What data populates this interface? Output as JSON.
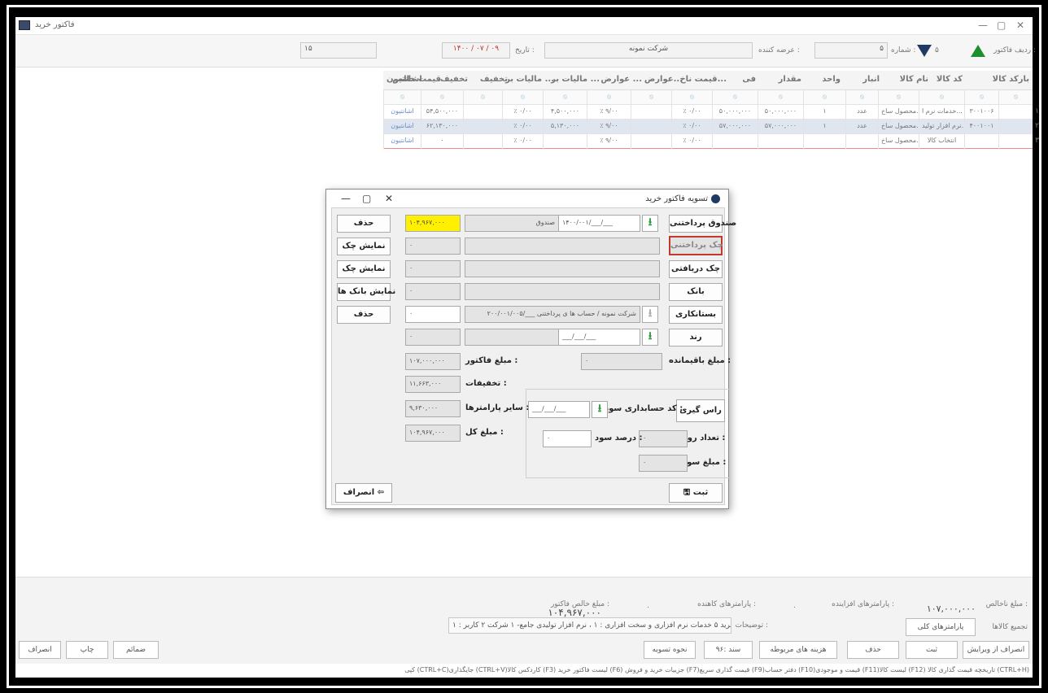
{
  "window": {
    "title": "فاکتور خرید",
    "ctl_min": "—",
    "ctl_max": "▢",
    "ctl_close": "✕"
  },
  "header": {
    "row_label": "ردیف فاکتور :",
    "row_value": "۵",
    "number_label": "شماره :",
    "number_value": "۵",
    "supplier_label": "عرضه کننده :",
    "company": "شرکت نمونه",
    "date_label": "تاریخ :",
    "date_value": "۱۴۰۰ / ۰۷ / ۰۹",
    "count": "۱۵"
  },
  "grid": {
    "headers": [
      "بارکد کالا",
      "کد کالا",
      "نام کالا",
      "انبار",
      "واحد",
      "مقدار",
      "فی",
      "قیمت ناخ...",
      "عوارض...",
      "عوارض ...",
      "مالیات بر ...",
      "مالیات بر ...",
      "تخفیف",
      "تخفیف",
      "قیمت خالص",
      "اشانتیون"
    ],
    "rows": [
      {
        "num": "۱",
        "barcode": "",
        "code": "۳۰۰۱۰۰۶",
        "name": "خدمات نرم ا...",
        "warehouse": "محصول ساخ...",
        "unit": "عدد",
        "qty": "۱",
        "price": "۵۰,۰۰۰,۰۰۰",
        "gross": "۵۰,۰۰۰,۰۰۰",
        "duty1": "٪ ۰/۰۰",
        "duty2": "",
        "tax1": "٪ ۹/۰۰",
        "tax2": "۴,۵۰۰,۰۰۰",
        "disc1": "٪ ۰/۰۰",
        "disc2": "",
        "net": "۵۴,۵۰۰,۰۰۰",
        "bonus": "اشانتیون"
      },
      {
        "num": "۲",
        "barcode": "",
        "code": "۴۰۰۱۰۰۱",
        "name": "نرم افزار تولید...",
        "warehouse": "محصول ساخ...",
        "unit": "عدد",
        "qty": "۱",
        "price": "۵۷,۰۰۰,۰۰۰",
        "gross": "۵۷,۰۰۰,۰۰۰",
        "duty1": "٪ ۰/۰۰",
        "duty2": "",
        "tax1": "٪ ۹/۰۰",
        "tax2": "۵,۱۳۰,۰۰۰",
        "disc1": "٪ ۰/۰۰",
        "disc2": "",
        "net": "۶۲,۱۳۰,۰۰۰",
        "bonus": "اشانتیون"
      },
      {
        "num": "۳",
        "barcode": "",
        "code": "",
        "name": "انتخاب کالا",
        "warehouse": "محصول ساخ...",
        "unit": "",
        "qty": "",
        "price": "",
        "gross": "",
        "duty1": "٪ ۰/۰۰",
        "duty2": "",
        "tax1": "٪ ۹/۰۰",
        "tax2": "",
        "disc1": "٪ ۰/۰۰",
        "disc2": "",
        "net": "۰",
        "bonus": "اشانتیون"
      }
    ]
  },
  "dialog": {
    "title": "تسویه فاکتور خرید",
    "ctl_min": "—",
    "ctl_max": "▢",
    "ctl_close": "✕",
    "cash_button": "صندوق پرداختنی",
    "cash_date": "۱۴۰۰/۰۰۱/___/___",
    "cash_name": "صندوق",
    "cash_amount": "۱۰۴,۹۶۷,۰۰۰",
    "delete1": "حذف",
    "cheque_paid_button": "چک پرداختنی",
    "cheque_paid_amount": "۰",
    "show_cheque1": "نمایش چک",
    "cheque_recv_button": "چک دریافتی",
    "cheque_recv_amount": "۰",
    "show_cheque2": "نمایش چک",
    "bank_button": "بانک",
    "bank_amount": "۰",
    "show_banks": "نمایش بانک ها",
    "creditor_button": "بستانکاری",
    "creditor_date": "۲۰۰/۰۰۱/۰۰۵/___",
    "creditor_name": "شرکت نمونه / حساب ها ی پرداختنی",
    "creditor_amount": "۰",
    "delete2": "حذف",
    "round_button": "رند",
    "round_date": "___/___/___",
    "round_amount": "۰",
    "invoice_amount_label": "مبلغ فاکتور :",
    "invoice_amount": "۱۰۷,۰۰۰,۰۰۰",
    "discounts_label": "تخفیفات :",
    "discounts": "۱۱,۶۶۳,۰۰۰",
    "other_params_label": "سایر پارامترها :",
    "other_params": "۹,۶۳۰,۰۰۰",
    "total_label": "مبلغ کل :",
    "total": "۱۰۴,۹۶۷,۰۰۰",
    "remaining_label": "مبلغ باقیمانده :",
    "remaining": "۰",
    "interest_code_label": "کد حسابداری سود :",
    "interest_date": "___/___/___",
    "settle_button": "راس گیری",
    "days_label": "تعداد روز :",
    "days": "۰",
    "interest_percent_label": "درصد سود :",
    "interest_percent": "۰",
    "interest_amount_label": "مبلغ سود :",
    "interest_amount": "۰",
    "save_button": "ثبت",
    "cancel_button": "انصراف"
  },
  "bottom": {
    "net_label": "مبلغ ناخالص :",
    "net_value": "۱۰۷,۰۰۰,۰۰۰",
    "add_params_label": "پارامترهای افزاینده :",
    "add_params_value": "۰",
    "reduce_params_label": "پارامترهای کاهنده :",
    "reduce_params_value": "۰",
    "net_invoice_label": "مبلغ خالص فاکتور :",
    "net_invoice_value": "۱۰۴,۹۶۷,۰۰۰",
    "merge_label": "تجمیع کالاها",
    "general_params": "پارامترهای کلی",
    "notes_label": "توضیحات :",
    "notes": "فاکتور خرید ۵ خدمات نرم افزاری و سخت افزاری : ۱ ، نرم افزار تولیدی جامع- ۱ شرکت ۲ کاربر : ۱",
    "cancel_edit": "انصراف از ویرایش",
    "save": "ثبت",
    "delete": "حذف",
    "related_costs": "هزینه های مربوطه",
    "doc": "سند :۹۶",
    "settle_method": "نحوه تسویه",
    "attachments": "ضمائم",
    "print": "چاپ",
    "cancel": "انصراف",
    "shortcuts": "کپی (CTRL+C)جایگذاری (CTRL+V)کاردکس کالا (F3) لیست فاکتور خرید (F6) جزییات خرید و فروش (F7)قیمت گذاری سریع (F9)دفتر حساب (F10)قیمت و موجودی (F11)لیست کالا (F12) تاریخچه قیمت گذاری کالا (CTRL+H)"
  }
}
